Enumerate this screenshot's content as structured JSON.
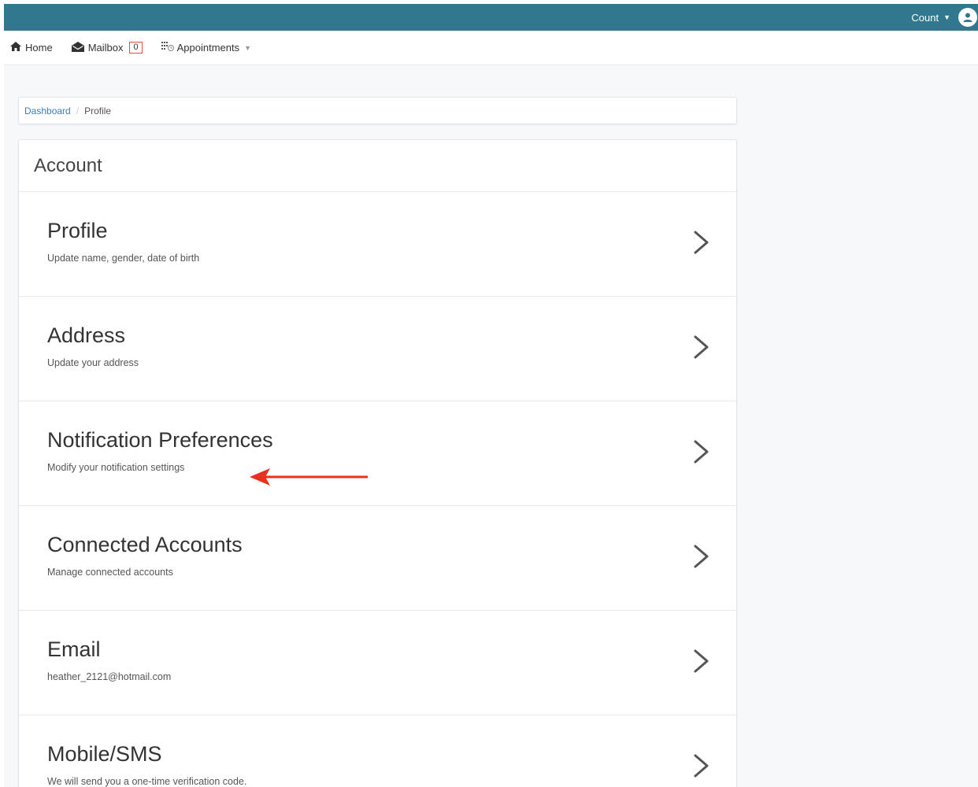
{
  "topbar": {
    "user_name": "Count",
    "bg_color": "#31788e"
  },
  "nav": {
    "home": "Home",
    "mailbox": "Mailbox",
    "mailbox_count": "0",
    "appointments": "Appointments"
  },
  "breadcrumb": {
    "dashboard": "Dashboard",
    "separator": "/",
    "current": "Profile"
  },
  "panel": {
    "heading": "Account",
    "rows": [
      {
        "title": "Profile",
        "subtitle": "Update name, gender, date of birth"
      },
      {
        "title": "Address",
        "subtitle": "Update your address"
      },
      {
        "title": "Notification Preferences",
        "subtitle": "Modify your notification settings"
      },
      {
        "title": "Connected Accounts",
        "subtitle": "Manage connected accounts"
      },
      {
        "title": "Email",
        "subtitle": "heather_2121@hotmail.com"
      },
      {
        "title": "Mobile/SMS",
        "subtitle": "We will send you a one-time verification code."
      }
    ]
  },
  "annotation": {
    "arrow_color": "#e8321f",
    "points_to": "Connected Accounts"
  },
  "icons": {
    "home": "home-icon",
    "mailbox": "envelope-open-icon",
    "appointments": "calendar-grid-icon",
    "avatar": "user-avatar-icon",
    "row_action": "chevron-right-icon"
  }
}
